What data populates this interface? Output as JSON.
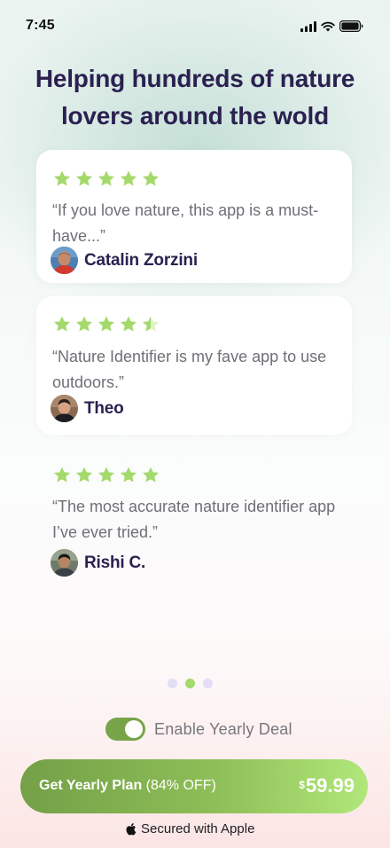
{
  "status_bar": {
    "time": "7:45",
    "icons": [
      "cellular-signal-icon",
      "wifi-icon",
      "battery-icon"
    ]
  },
  "headline": "Helping hundreds of nature lovers around the wold",
  "reviews": [
    {
      "rating": 5,
      "quote": "“If you love nature, this app is a must-have...”",
      "author": "Catalin Zorzini"
    },
    {
      "rating": 4.5,
      "quote": "“Nature Identifier is my fave app to use outdoors.”",
      "author": "Theo"
    },
    {
      "rating": 5,
      "quote": "“The most accurate nature identifier app I’ve ever tried.”",
      "author": "Rishi C."
    }
  ],
  "pager": {
    "total": 3,
    "active_index": 1
  },
  "yearly_deal": {
    "label": "Enable Yearly Deal",
    "enabled": true
  },
  "cta": {
    "title": "Get Yearly Plan",
    "discount": "(84% OFF)",
    "currency": "$",
    "price": "59.99"
  },
  "secured": {
    "icon": "apple-icon",
    "text": "Secured with Apple"
  },
  "colors": {
    "heading": "#2b2150",
    "star": "#a4d96b",
    "accent_green": "#77a449",
    "cta_gradient_start": "#74a047",
    "cta_gradient_end": "#b1e77a",
    "dot_inactive": "#e3ddf5"
  }
}
